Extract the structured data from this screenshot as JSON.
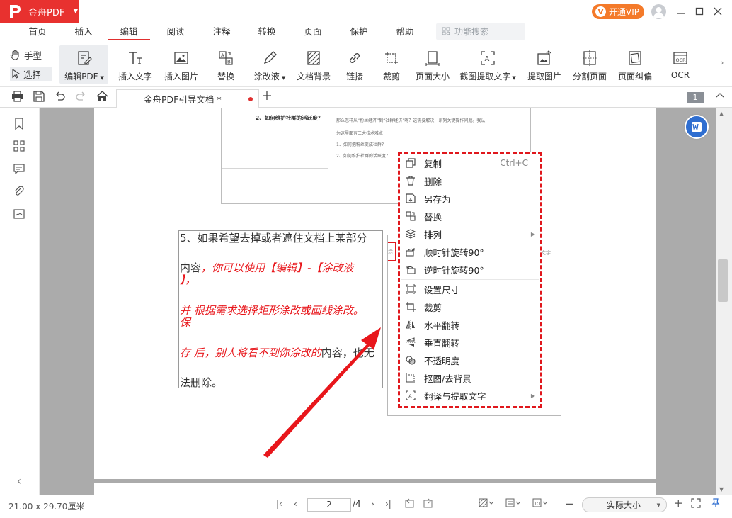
{
  "app": {
    "name": "金舟PDF",
    "vip_label": "开通VIP",
    "vip_badge": "V"
  },
  "menu": {
    "items": [
      "首页",
      "插入",
      "编辑",
      "阅读",
      "注释",
      "转换",
      "页面",
      "保护",
      "帮助"
    ],
    "active": "编辑",
    "search_placeholder": "功能搜索"
  },
  "toolbar": {
    "hand": "手型",
    "select": "选择",
    "tools": [
      "编辑PDF",
      "插入文字",
      "插入图片",
      "替换",
      "涂改液",
      "文档背景",
      "链接",
      "裁剪",
      "页面大小",
      "截图提取文字",
      "提取图片",
      "分割页面",
      "页面纠偏",
      "OCR"
    ]
  },
  "tabs": {
    "doc_title": "金舟PDF引导文档 *",
    "page_badge": "1"
  },
  "document": {
    "embed_heading": "2、如何维护社群的活跃度？",
    "embed_lines": [
      "那么怎样从“粉丝经济”到“社群经济”呢？这需要解决一系列关键操作问题。我认",
      "为这里面有三大技术难点：",
      "1、如何把粉丝变成社群？",
      "2、如何维护社群的活跃度？"
    ],
    "text_lines": [
      {
        "black": "5、如果希望去掉或者遮住文档上某部分",
        "red": ""
      },
      {
        "black": "内容",
        "red": "，你可以使用【编辑】-【涂改液"
      },
      {
        "black": "",
        "red": "】，"
      },
      {
        "black": "",
        "red": "并 根据需求选择矩形涂改或画线涂改。"
      },
      {
        "black": "",
        "red": "保"
      },
      {
        "black": "",
        "red": "存 后，别人将看不到你涂改的",
        "black2": "内容，也无"
      },
      {
        "black": "法删除。",
        "red": ""
      }
    ],
    "subwin_left_label": "涂",
    "subwin_right_label": "文字"
  },
  "context_menu": {
    "items": [
      {
        "label": "复制",
        "shortcut": "Ctrl+C",
        "icon": "copy-icon"
      },
      {
        "label": "删除",
        "icon": "trash-icon"
      },
      {
        "label": "另存为",
        "icon": "save-as-icon"
      },
      {
        "label": "替换",
        "icon": "replace-icon"
      },
      {
        "label": "排列",
        "icon": "layers-icon",
        "submenu": true
      },
      {
        "label": "顺时针旋转90°",
        "icon": "rotate-cw-icon"
      },
      {
        "label": "逆时针旋转90°",
        "icon": "rotate-ccw-icon"
      },
      {
        "label": "设置尺寸",
        "icon": "resize-icon"
      },
      {
        "label": "裁剪",
        "icon": "crop-icon"
      },
      {
        "label": "水平翻转",
        "icon": "flip-horizontal-icon"
      },
      {
        "label": "垂直翻转",
        "icon": "flip-vertical-icon"
      },
      {
        "label": "不透明度",
        "icon": "opacity-icon"
      },
      {
        "label": "抠图/去背景",
        "icon": "cutout-icon"
      },
      {
        "label": "翻译与提取文字",
        "icon": "translate-icon",
        "submenu": true
      }
    ]
  },
  "status": {
    "page_size": "21.00 x 29.70厘米",
    "current_page": "2",
    "total_pages": "/4",
    "zoom": "实际大小"
  },
  "colors": {
    "accent": "#e02f2f",
    "vip": "#f47a2a",
    "arrow": "#e8161b"
  }
}
